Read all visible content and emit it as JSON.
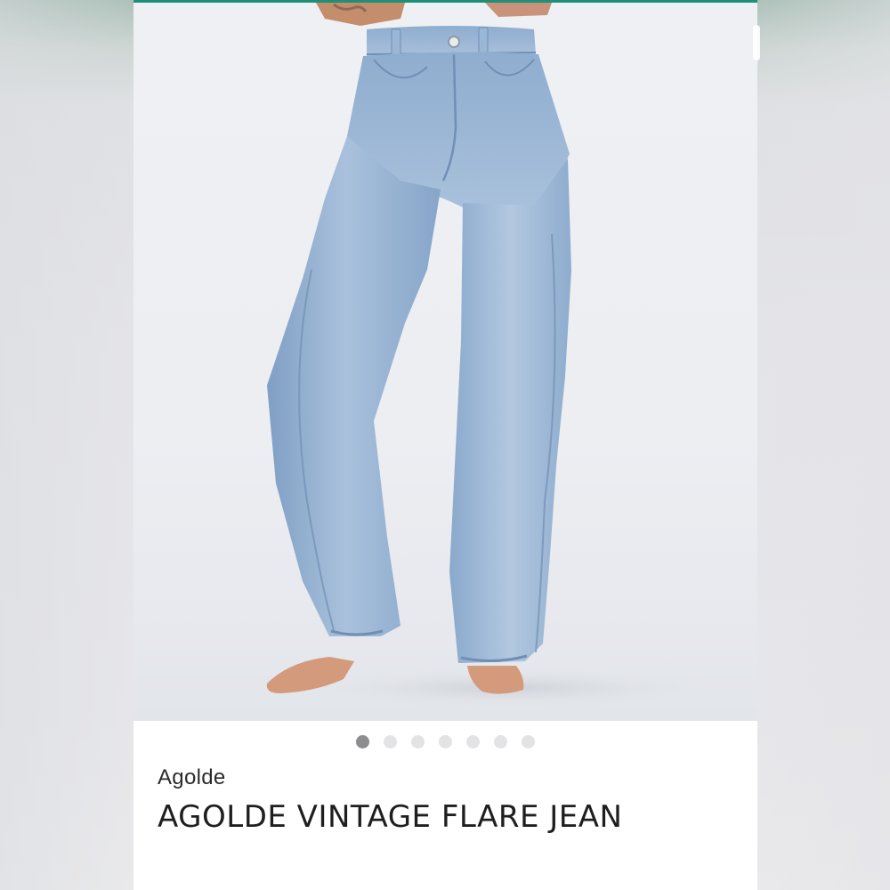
{
  "carousel": {
    "total_images": 7,
    "active_index": 1
  },
  "product": {
    "brand": "Agolde",
    "title": "AGOLDE VINTAGE FLARE JEAN"
  },
  "colors": {
    "accent": "#1f8f78",
    "dot_active": "#8d8d90",
    "dot_inactive": "#e3e3e5"
  },
  "icons": {
    "photo": "product-photo"
  }
}
